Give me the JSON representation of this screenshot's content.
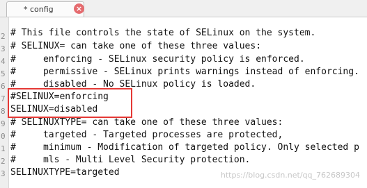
{
  "tab": {
    "title": "* config",
    "close_icon": "close-icon"
  },
  "gutter": {
    "line_numbers": [
      "2",
      "3",
      "4",
      "5",
      "6",
      "7",
      "8",
      "9",
      "0",
      "1",
      "2",
      "3"
    ]
  },
  "editor": {
    "lines": [
      "# This file controls the state of SELinux on the system.",
      "# SELINUX= can take one of these three values:",
      "#     enforcing - SELinux security policy is enforced.",
      "#     permissive - SELinux prints warnings instead of enforcing.",
      "#     disabled - No SELinux policy is loaded.",
      "#SELINUX=enforcing",
      "SELINUX=disabled",
      "# SELINUXTYPE= can take one of these three values:",
      "#     targeted - Targeted processes are protected,",
      "#     minimum - Modification of targeted policy. Only selected p",
      "#     mls - Multi Level Security protection.",
      "SELINUXTYPE=targeted"
    ]
  },
  "watermark": "https://blog.csdn.net/qq_762689304",
  "colors": {
    "highlight": "#e53935",
    "tab_close": "#e56b6f"
  }
}
